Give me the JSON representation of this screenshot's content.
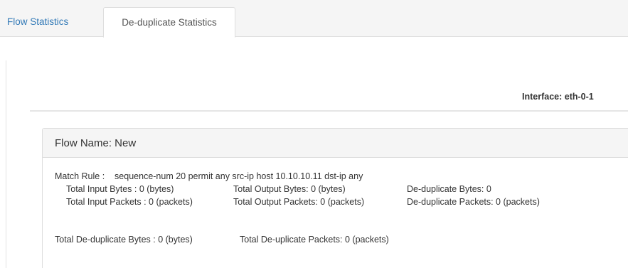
{
  "tabs": [
    {
      "label": "Flow Statistics",
      "active": false
    },
    {
      "label": "De-duplicate Statistics",
      "active": true
    }
  ],
  "interface": {
    "label": "Interface: eth-0-1"
  },
  "flow": {
    "name": "Flow Name: New",
    "match_rule": "Match Rule :    sequence-num 20 permit any src-ip host 10.10.10.11 dst-ip any",
    "stats": {
      "total_input_bytes": "Total Input Bytes : 0 (bytes)",
      "total_output_bytes": "Total Output Bytes: 0 (bytes)",
      "dedup_bytes": "De-duplicate Bytes: 0",
      "total_input_packets": "Total Input Packets : 0 (packets)",
      "total_output_packets": "Total Output Packets: 0 (packets)",
      "dedup_packets": "De-duplicate Packets: 0 (packets)"
    },
    "totals": {
      "total_dedup_bytes": "Total De-duplicate Bytes : 0 (bytes)",
      "total_dedup_packets": "Total De-uplicate Packets: 0 (packets)"
    }
  },
  "colors": {
    "link": "#337ab7",
    "border": "#dddddd",
    "heading_bg": "#f5f5f5",
    "text": "#333333"
  }
}
